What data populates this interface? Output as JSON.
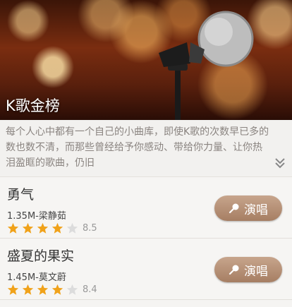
{
  "hero": {
    "title": "K歌金榜"
  },
  "description": {
    "text": "每个人心中都有一个自己的小曲库，即使K歌的次数早已多的数也数不清，而那些曾经给予你感动、带给你力量、让你热泪盈眶的歌曲，仍旧"
  },
  "songs": [
    {
      "name": "勇气",
      "meta": "1.35M-梁静茹",
      "rating": 4,
      "score": "8.5",
      "button_label": "演唱"
    },
    {
      "name": "盛夏的果实",
      "meta": "1.45M-莫文蔚",
      "rating": 4,
      "score": "8.4",
      "button_label": "演唱"
    }
  ],
  "colors": {
    "star_on": "#f0a21a",
    "star_off": "#dcdcdc",
    "button": "#b38c70"
  }
}
